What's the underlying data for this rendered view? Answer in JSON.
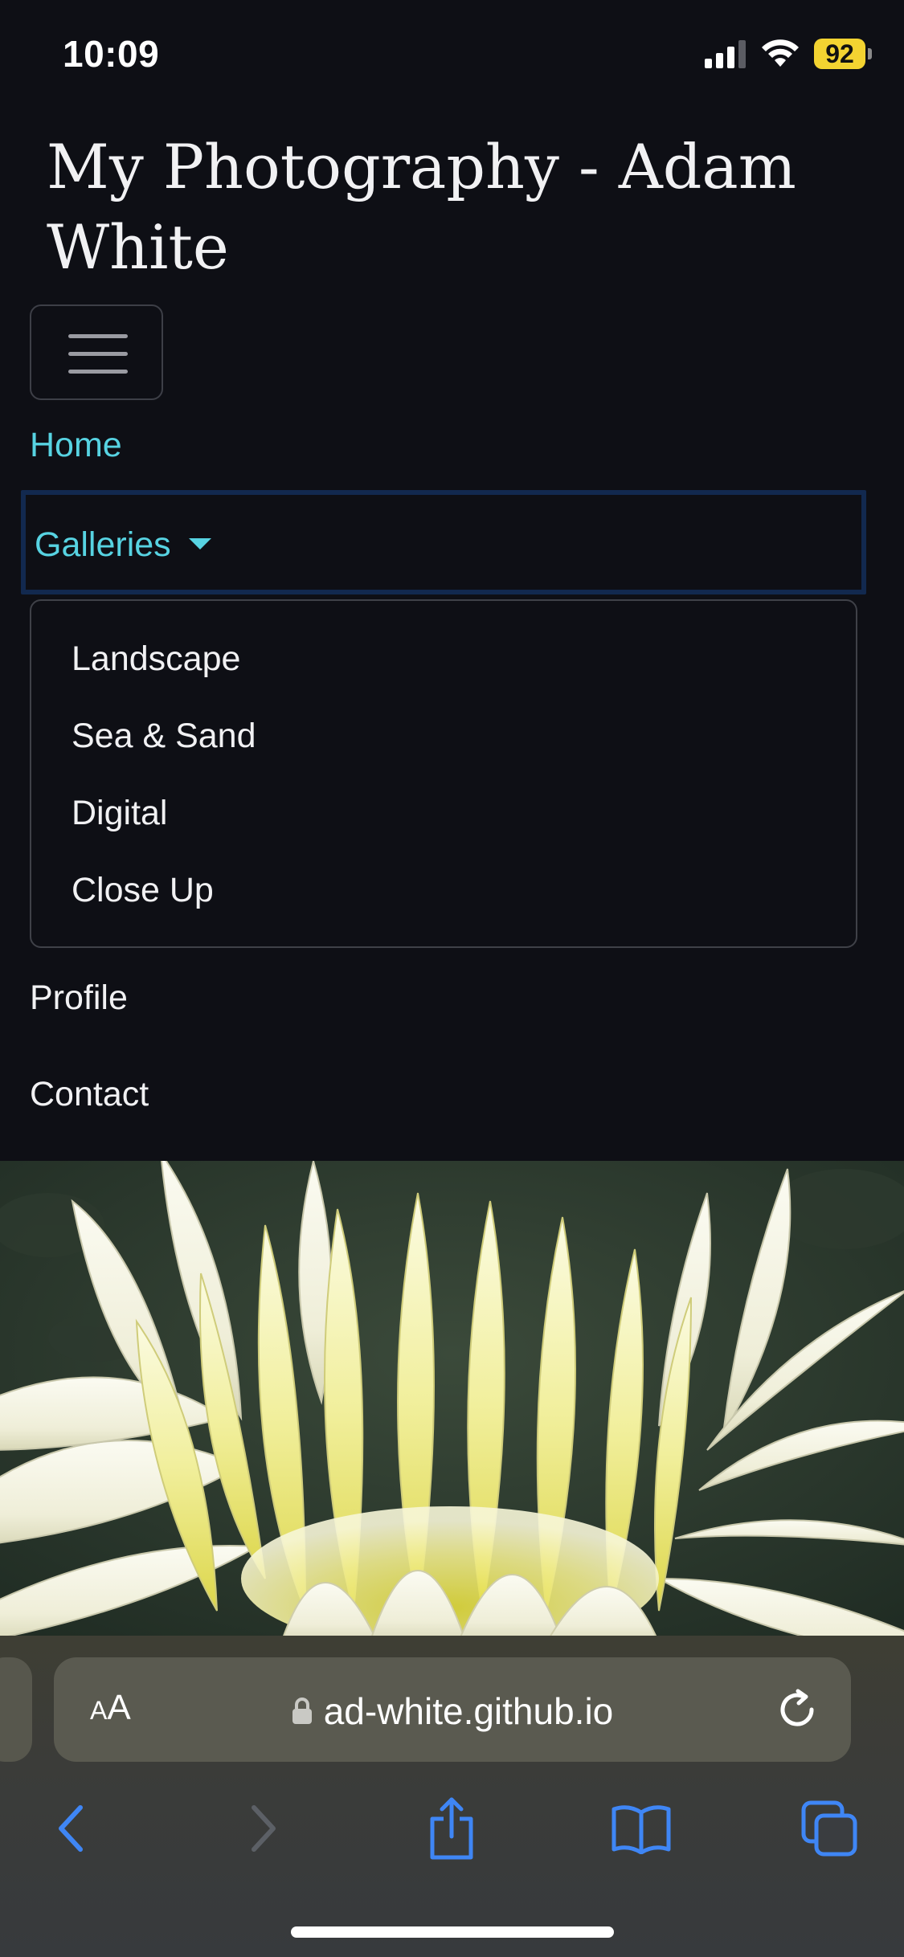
{
  "status_bar": {
    "time": "10:09",
    "battery_level": "92",
    "battery_color": "#f3d331"
  },
  "site": {
    "title": "My Photography - Adam White",
    "accent_color": "#57d3e2"
  },
  "nav": {
    "toggler_icon": "hamburger-icon",
    "home": "Home",
    "galleries": "Galleries",
    "galleries_items": [
      "Landscape",
      "Sea & Sand",
      "Digital",
      "Close Up"
    ],
    "profile": "Profile",
    "contact": "Contact"
  },
  "hero": {
    "subject": "white-yellow-dahlia-photo"
  },
  "browser": {
    "text_size_label_small": "A",
    "text_size_label_large": "A",
    "url": "ad-white.github.io",
    "toolbar_icons": [
      "back-icon",
      "forward-icon",
      "share-icon",
      "bookmarks-icon",
      "tabs-icon"
    ],
    "icon_color": "#3f86f5"
  }
}
